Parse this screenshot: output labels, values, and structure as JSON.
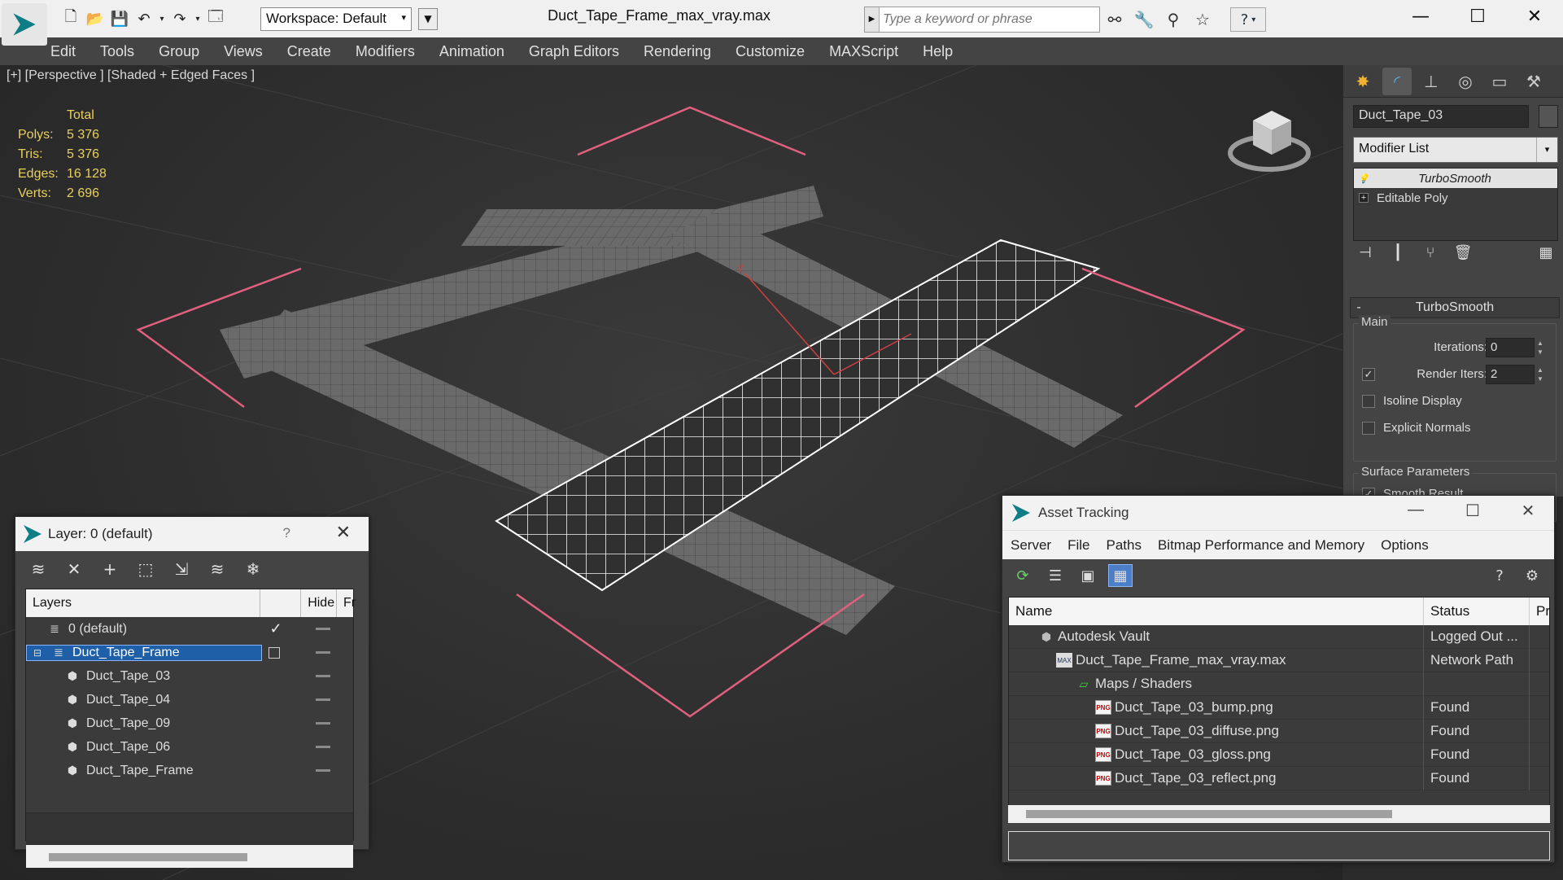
{
  "window": {
    "title": "Duct_Tape_Frame_max_vray.max",
    "workspace": "Workspace: Default",
    "search_placeholder": "Type a keyword or phrase"
  },
  "menu": [
    "Edit",
    "Tools",
    "Group",
    "Views",
    "Create",
    "Modifiers",
    "Animation",
    "Graph Editors",
    "Rendering",
    "Customize",
    "MAXScript",
    "Help"
  ],
  "viewport": {
    "label": "[+] [Perspective ] [Shaded + Edged Faces ]",
    "stats_header": "Total",
    "stats": [
      {
        "label": "Polys:",
        "value": "5 376"
      },
      {
        "label": "Tris:",
        "value": "5 376"
      },
      {
        "label": "Edges:",
        "value": "16 128"
      },
      {
        "label": "Verts:",
        "value": "2 696"
      }
    ]
  },
  "command_panel": {
    "object_name": "Duct_Tape_03",
    "modifier_list": "Modifier List",
    "stack": [
      {
        "label": "TurboSmooth",
        "selected": true
      },
      {
        "label": "Editable Poly",
        "selected": false
      }
    ],
    "rollout_title": "TurboSmooth",
    "group_main": "Main",
    "iterations_label": "Iterations:",
    "iterations_value": "0",
    "render_iters_label": "Render Iters:",
    "render_iters_value": "2",
    "isoline_display": "Isoline Display",
    "explicit_normals": "Explicit Normals",
    "group_surface": "Surface Parameters",
    "smooth_result": "Smooth Result"
  },
  "layer_dialog": {
    "title": "Layer: 0 (default)",
    "help": "?",
    "col_layers": "Layers",
    "col_hide": "Hide",
    "col_fr": "Fr",
    "rows": [
      {
        "name": "0 (default)",
        "indent": 1,
        "type": "layer"
      },
      {
        "name": "Duct_Tape_Frame",
        "indent": 1,
        "type": "layer",
        "selected": true
      },
      {
        "name": "Duct_Tape_03",
        "indent": 2,
        "type": "object"
      },
      {
        "name": "Duct_Tape_04",
        "indent": 2,
        "type": "object"
      },
      {
        "name": "Duct_Tape_09",
        "indent": 2,
        "type": "object"
      },
      {
        "name": "Duct_Tape_06",
        "indent": 2,
        "type": "object"
      },
      {
        "name": "Duct_Tape_Frame",
        "indent": 2,
        "type": "object"
      }
    ]
  },
  "asset_dialog": {
    "title": "Asset Tracking",
    "menu": [
      "Server",
      "File",
      "Paths",
      "Bitmap Performance and Memory",
      "Options"
    ],
    "col_name": "Name",
    "col_status": "Status",
    "col_pr": "Pr",
    "rows": [
      {
        "name": "Autodesk Vault",
        "status": "Logged Out ...",
        "indent": 0,
        "icon": "vault-icon"
      },
      {
        "name": "Duct_Tape_Frame_max_vray.max",
        "status": "Network Path",
        "indent": 1,
        "icon": "max-file-icon"
      },
      {
        "name": "Maps / Shaders",
        "status": "",
        "indent": 2,
        "icon": "maps-icon"
      },
      {
        "name": "Duct_Tape_03_bump.png",
        "status": "Found",
        "indent": 3,
        "icon": "png-icon"
      },
      {
        "name": "Duct_Tape_03_diffuse.png",
        "status": "Found",
        "indent": 3,
        "icon": "png-icon"
      },
      {
        "name": "Duct_Tape_03_gloss.png",
        "status": "Found",
        "indent": 3,
        "icon": "png-icon"
      },
      {
        "name": "Duct_Tape_03_reflect.png",
        "status": "Found",
        "indent": 3,
        "icon": "png-icon"
      }
    ]
  },
  "colors": {
    "panel_bg": "#444444",
    "viewport_bg": "#2e2e2e",
    "stats_yellow": "#e8d060",
    "selection_blue": "#1f5fa8",
    "frame_pink": "#e0607f"
  }
}
